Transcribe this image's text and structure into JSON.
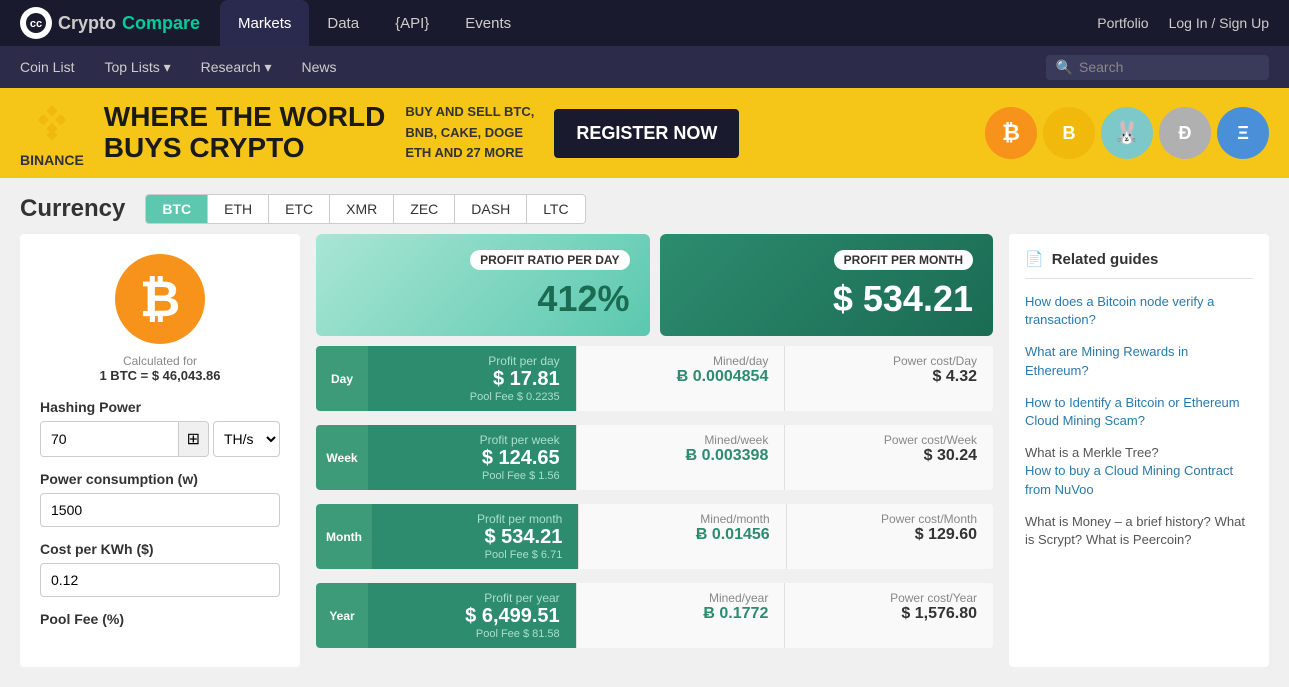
{
  "logo": {
    "text_crypto": "Crypto",
    "text_compare": "Compare"
  },
  "top_nav": {
    "items": [
      {
        "label": "Markets",
        "active": true
      },
      {
        "label": "Data",
        "active": false
      },
      {
        "label": "{API}",
        "active": false
      },
      {
        "label": "Events",
        "active": false
      }
    ],
    "portfolio": "Portfolio",
    "login": "Log In / Sign Up"
  },
  "second_nav": {
    "items": [
      {
        "label": "Coin List"
      },
      {
        "label": "Top Lists ▾"
      },
      {
        "label": "Research ▾"
      },
      {
        "label": "News"
      }
    ],
    "search_placeholder": "Search"
  },
  "banner": {
    "brand": "BINANCE",
    "headline_line1": "WHERE THE WORLD",
    "headline_line2": "BUYS CRYPTO",
    "sub": "BUY AND SELL BTC,\nBNB, CAKE, DOGE\nETH AND 27 MORE",
    "cta": "REGISTER NOW"
  },
  "currency": {
    "title": "Currency",
    "tabs": [
      "BTC",
      "ETH",
      "ETC",
      "XMR",
      "ZEC",
      "DASH",
      "LTC"
    ],
    "active_tab": "BTC"
  },
  "calculator": {
    "btc_symbol": "₿",
    "calc_for": "Calculated for",
    "rate": "1 BTC = $ 46,043.86",
    "hashing_power_label": "Hashing Power",
    "hashing_power_value": "70",
    "hashing_unit": "TH/s",
    "power_consumption_label": "Power consumption (w)",
    "power_consumption_value": "1500",
    "cost_per_kwh_label": "Cost per KWh ($)",
    "cost_per_kwh_value": "0.12",
    "pool_fee_label": "Pool Fee (%)"
  },
  "profit_day": {
    "label": "PROFIT RATIO PER DAY",
    "value": "412%"
  },
  "profit_month": {
    "label": "PROFIT PER MONTH",
    "value": "$ 534.21"
  },
  "rows": [
    {
      "period": "Day",
      "profit_label": "Profit per day",
      "profit_value": "$ 17.81",
      "pool_fee": "Pool Fee $ 0.2235",
      "mined_label": "Mined/day",
      "mined_value": "Ƀ 0.0004854",
      "power_label": "Power cost/Day",
      "power_value": "$ 4.32"
    },
    {
      "period": "Week",
      "profit_label": "Profit per week",
      "profit_value": "$ 124.65",
      "pool_fee": "Pool Fee $ 1.56",
      "mined_label": "Mined/week",
      "mined_value": "Ƀ 0.003398",
      "power_label": "Power cost/Week",
      "power_value": "$ 30.24"
    },
    {
      "period": "Month",
      "profit_label": "Profit per month",
      "profit_value": "$ 534.21",
      "pool_fee": "Pool Fee $ 6.71",
      "mined_label": "Mined/month",
      "mined_value": "Ƀ 0.01456",
      "power_label": "Power cost/Month",
      "power_value": "$ 129.60"
    },
    {
      "period": "Year",
      "profit_label": "Profit per year",
      "profit_value": "$ 6,499.51",
      "pool_fee": "Pool Fee $ 81.58",
      "mined_label": "Mined/year",
      "mined_value": "Ƀ 0.1772",
      "power_label": "Power cost/Year",
      "power_value": "$ 1,576.80"
    }
  ],
  "related_guides": {
    "title": "Related guides",
    "links": [
      "How does a Bitcoin node verify a transaction?",
      "What are Mining Rewards in Ethereum?",
      "How to Identify a Bitcoin or Ethereum Cloud Mining Scam?",
      "What is a Merkle Tree?",
      "How to buy a Cloud Mining Contract from NuVoo",
      "What is Money – a brief history?",
      "What is Scrypt?",
      "What is Peercoin?"
    ]
  }
}
